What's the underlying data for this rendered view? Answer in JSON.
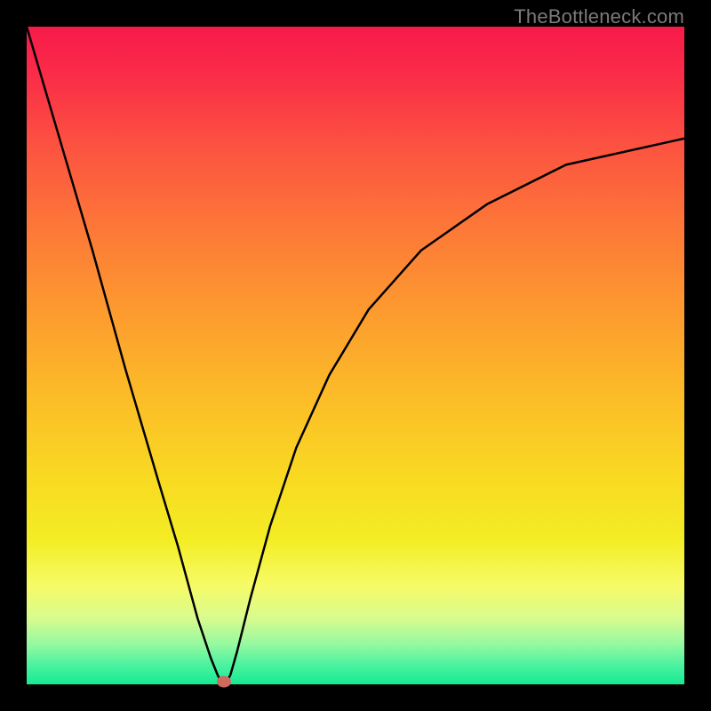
{
  "watermark": "TheBottleneck.com",
  "chart_data": {
    "type": "line",
    "title": "",
    "xlabel": "",
    "ylabel": "",
    "xlim": [
      0,
      100
    ],
    "ylim": [
      0,
      100
    ],
    "series": [
      {
        "name": "curve",
        "x": [
          0,
          5,
          10,
          15,
          20,
          23,
          26,
          28,
          29,
          29.5,
          30,
          30.5,
          31,
          32,
          34,
          37,
          41,
          46,
          52,
          60,
          70,
          82,
          100
        ],
        "values": [
          100,
          83,
          66,
          48,
          31,
          21,
          10,
          4,
          1.5,
          0.5,
          0.4,
          0.5,
          1.5,
          5,
          13,
          24,
          36,
          47,
          57,
          66,
          73,
          79,
          83
        ]
      }
    ],
    "marker": {
      "x": 30,
      "y": 0.4
    },
    "background_gradient": [
      {
        "stop": 0.0,
        "color": "#f71a4a"
      },
      {
        "stop": 0.07,
        "color": "#fa2b48"
      },
      {
        "stop": 0.18,
        "color": "#fc5241"
      },
      {
        "stop": 0.3,
        "color": "#fd7638"
      },
      {
        "stop": 0.42,
        "color": "#fd9730"
      },
      {
        "stop": 0.55,
        "color": "#fcb928"
      },
      {
        "stop": 0.68,
        "color": "#f9d822"
      },
      {
        "stop": 0.78,
        "color": "#f3ed24"
      },
      {
        "stop": 0.85,
        "color": "#f6fb67"
      },
      {
        "stop": 0.9,
        "color": "#d8fb8f"
      },
      {
        "stop": 0.94,
        "color": "#93f9a0"
      },
      {
        "stop": 0.97,
        "color": "#4df2a0"
      },
      {
        "stop": 1.0,
        "color": "#15eb93"
      }
    ]
  }
}
